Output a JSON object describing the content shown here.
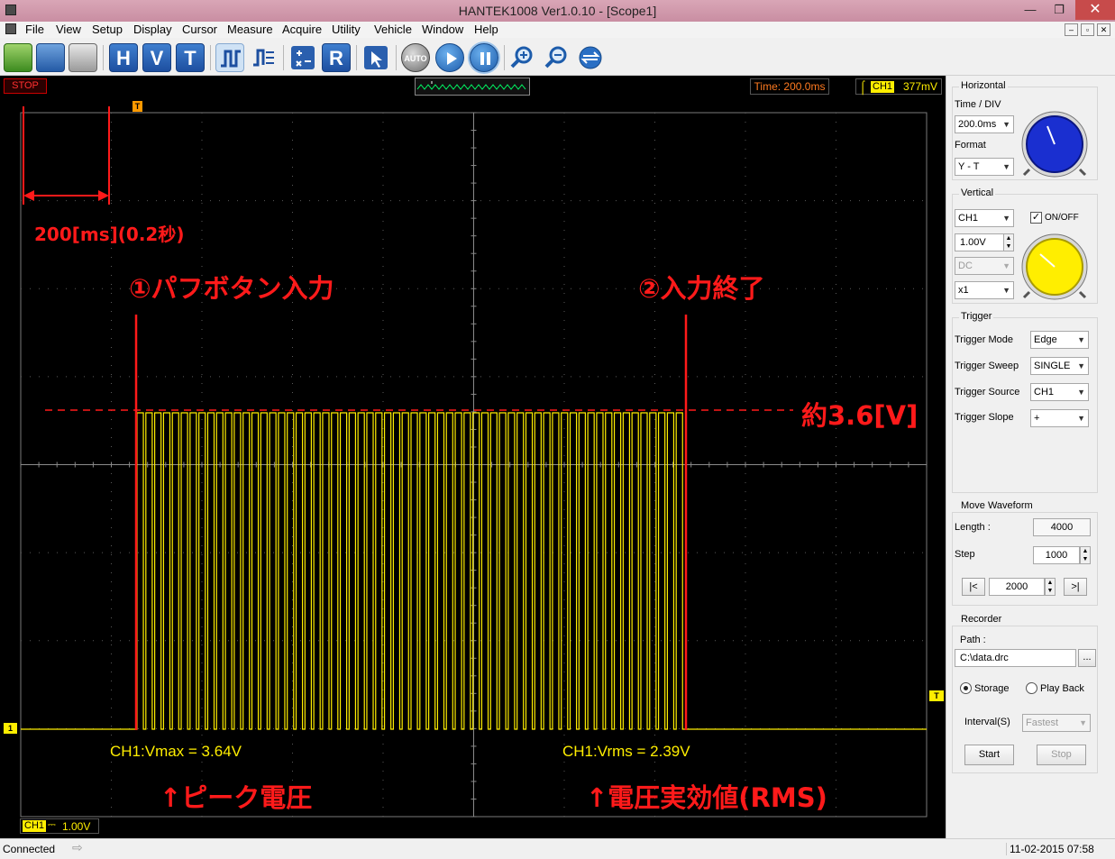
{
  "window": {
    "title": "HANTEK1008 Ver1.0.10 - [Scope1]",
    "min_glyph": "—",
    "max_glyph": "❐",
    "close_glyph": "✕"
  },
  "menu": [
    "File",
    "View",
    "Setup",
    "Display",
    "Cursor",
    "Measure",
    "Acquire",
    "Utility",
    "Vehicle",
    "Window",
    "Help"
  ],
  "mdi_buttons": [
    "–",
    "▫",
    "✕"
  ],
  "toolbar": {
    "h_label": "H",
    "v_label": "V",
    "t_label": "T",
    "r_label": "R",
    "auto_label": "AUTO"
  },
  "scope": {
    "status": "STOP",
    "time_readout": "Time: 200.0ms",
    "trigger_channel": "CH1",
    "trigger_level": "377mV",
    "trigger_marker": "T",
    "channel_marker": "1",
    "bottom_channel": "CH1",
    "bottom_coupling": "⎓",
    "bottom_scale": "1.00V",
    "measure_vmax": "CH1:Vmax = 3.64V",
    "measure_vrms": "CH1:Vrms = 2.39V",
    "colors": {
      "trace": "#ffee00",
      "grid": "#5a5a5a",
      "annotation": "#ff1a1a"
    },
    "pulse_count": 62,
    "annotations": {
      "timebase": "200[ms](0.2秒)",
      "start": "①パフボタン入力",
      "end": "②入力終了",
      "level": "約3.6[V]",
      "peak": "↑ピーク電圧",
      "rms": "↑電圧実効値(RMS)"
    }
  },
  "horizontal": {
    "group": "Horizontal",
    "timediv_label": "Time / DIV",
    "timediv_value": "200.0ms",
    "format_label": "Format",
    "format_value": "Y - T"
  },
  "vertical": {
    "group": "Vertical",
    "channel": "CH1",
    "onoff_label": "ON/OFF",
    "onoff_checked": true,
    "volts": "1.00V",
    "coupling": "DC",
    "probe": "x1"
  },
  "trigger": {
    "group": "Trigger",
    "mode_label": "Trigger Mode",
    "mode_value": "Edge",
    "sweep_label": "Trigger Sweep",
    "sweep_value": "SINGLE",
    "source_label": "Trigger Source",
    "source_value": "CH1",
    "slope_label": "Trigger Slope",
    "slope_value": "+"
  },
  "move_waveform": {
    "group": "Move Waveform",
    "length_label": "Length :",
    "length_value": "4000",
    "step_label": "Step",
    "step_value": "1000",
    "first_label": "|<",
    "position_value": "2000",
    "last_label": ">|"
  },
  "recorder": {
    "group": "Recorder",
    "path_label": "Path :",
    "path_value": "C:\\data.drc",
    "browse_label": "...",
    "storage_label": "Storage",
    "playback_label": "Play Back",
    "interval_label": "Interval(S)",
    "interval_value": "Fastest",
    "start_label": "Start",
    "stop_label": "Stop"
  },
  "statusbar": {
    "left": "Connected",
    "right": "11-02-2015  07:58"
  }
}
